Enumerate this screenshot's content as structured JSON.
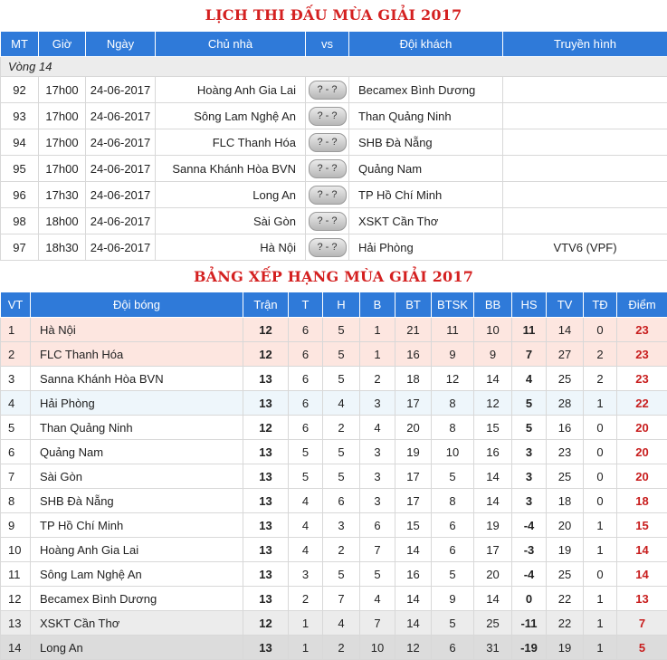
{
  "schedule": {
    "title": "LỊCH THI ĐẤU MÙA GIẢI 2017",
    "headers": [
      "MT",
      "Giờ",
      "Ngày",
      "Chủ nhà",
      "vs",
      "Đội khách",
      "Truyền hình"
    ],
    "round_label": "Vòng 14",
    "matches": [
      {
        "mt": "92",
        "time": "17h00",
        "date": "24-06-2017",
        "home": "Hoàng Anh Gia Lai",
        "score": "? - ?",
        "away": "Becamex Bình Dương",
        "tv": ""
      },
      {
        "mt": "93",
        "time": "17h00",
        "date": "24-06-2017",
        "home": "Sông Lam Nghệ An",
        "score": "? - ?",
        "away": "Than Quảng Ninh",
        "tv": ""
      },
      {
        "mt": "94",
        "time": "17h00",
        "date": "24-06-2017",
        "home": "FLC Thanh Hóa",
        "score": "? - ?",
        "away": "SHB Đà Nẵng",
        "tv": ""
      },
      {
        "mt": "95",
        "time": "17h00",
        "date": "24-06-2017",
        "home": "Sanna Khánh Hòa BVN",
        "score": "? - ?",
        "away": "Quảng Nam",
        "tv": ""
      },
      {
        "mt": "96",
        "time": "17h30",
        "date": "24-06-2017",
        "home": "Long An",
        "score": "? - ?",
        "away": "TP Hồ Chí Minh",
        "tv": ""
      },
      {
        "mt": "98",
        "time": "18h00",
        "date": "24-06-2017",
        "home": "Sài Gòn",
        "score": "? - ?",
        "away": "XSKT Cần Thơ",
        "tv": ""
      },
      {
        "mt": "97",
        "time": "18h30",
        "date": "24-06-2017",
        "home": "Hà Nội",
        "score": "? - ?",
        "away": "Hải Phòng",
        "tv": "VTV6 (VPF)"
      }
    ]
  },
  "standings": {
    "title": "BẢNG XẾP HẠNG MÙA GIẢI 2017",
    "headers": [
      "VT",
      "Đội bóng",
      "Trận",
      "T",
      "H",
      "B",
      "BT",
      "BTSK",
      "BB",
      "HS",
      "TV",
      "TĐ",
      "Điểm"
    ],
    "rows": [
      {
        "pos": "1",
        "team": "Hà Nội",
        "played": "12",
        "w": "6",
        "d": "5",
        "l": "1",
        "gf": "21",
        "gfa": "11",
        "ga": "10",
        "gd": "11",
        "yc": "14",
        "rc": "0",
        "pts": "23",
        "zone": "top"
      },
      {
        "pos": "2",
        "team": "FLC Thanh Hóa",
        "played": "12",
        "w": "6",
        "d": "5",
        "l": "1",
        "gf": "16",
        "gfa": "9",
        "ga": "9",
        "gd": "7",
        "yc": "27",
        "rc": "2",
        "pts": "23",
        "zone": "top"
      },
      {
        "pos": "3",
        "team": "Sanna Khánh Hòa BVN",
        "played": "13",
        "w": "6",
        "d": "5",
        "l": "2",
        "gf": "18",
        "gfa": "12",
        "ga": "14",
        "gd": "4",
        "yc": "25",
        "rc": "2",
        "pts": "23",
        "zone": ""
      },
      {
        "pos": "4",
        "team": "Hải Phòng",
        "played": "13",
        "w": "6",
        "d": "4",
        "l": "3",
        "gf": "17",
        "gfa": "8",
        "ga": "12",
        "gd": "5",
        "yc": "28",
        "rc": "1",
        "pts": "22",
        "zone": "qual"
      },
      {
        "pos": "5",
        "team": "Than Quảng Ninh",
        "played": "12",
        "w": "6",
        "d": "2",
        "l": "4",
        "gf": "20",
        "gfa": "8",
        "ga": "15",
        "gd": "5",
        "yc": "16",
        "rc": "0",
        "pts": "20",
        "zone": ""
      },
      {
        "pos": "6",
        "team": "Quảng Nam",
        "played": "13",
        "w": "5",
        "d": "5",
        "l": "3",
        "gf": "19",
        "gfa": "10",
        "ga": "16",
        "gd": "3",
        "yc": "23",
        "rc": "0",
        "pts": "20",
        "zone": ""
      },
      {
        "pos": "7",
        "team": "Sài Gòn",
        "played": "13",
        "w": "5",
        "d": "5",
        "l": "3",
        "gf": "17",
        "gfa": "5",
        "ga": "14",
        "gd": "3",
        "yc": "25",
        "rc": "0",
        "pts": "20",
        "zone": ""
      },
      {
        "pos": "8",
        "team": "SHB Đà Nẵng",
        "played": "13",
        "w": "4",
        "d": "6",
        "l": "3",
        "gf": "17",
        "gfa": "8",
        "ga": "14",
        "gd": "3",
        "yc": "18",
        "rc": "0",
        "pts": "18",
        "zone": ""
      },
      {
        "pos": "9",
        "team": "TP Hồ Chí Minh",
        "played": "13",
        "w": "4",
        "d": "3",
        "l": "6",
        "gf": "15",
        "gfa": "6",
        "ga": "19",
        "gd": "-4",
        "yc": "20",
        "rc": "1",
        "pts": "15",
        "zone": ""
      },
      {
        "pos": "10",
        "team": "Hoàng Anh Gia Lai",
        "played": "13",
        "w": "4",
        "d": "2",
        "l": "7",
        "gf": "14",
        "gfa": "6",
        "ga": "17",
        "gd": "-3",
        "yc": "19",
        "rc": "1",
        "pts": "14",
        "zone": ""
      },
      {
        "pos": "11",
        "team": "Sông Lam Nghệ An",
        "played": "13",
        "w": "3",
        "d": "5",
        "l": "5",
        "gf": "16",
        "gfa": "5",
        "ga": "20",
        "gd": "-4",
        "yc": "25",
        "rc": "0",
        "pts": "14",
        "zone": ""
      },
      {
        "pos": "12",
        "team": "Becamex Bình Dương",
        "played": "13",
        "w": "2",
        "d": "7",
        "l": "4",
        "gf": "14",
        "gfa": "9",
        "ga": "14",
        "gd": "0",
        "yc": "22",
        "rc": "1",
        "pts": "13",
        "zone": ""
      },
      {
        "pos": "13",
        "team": "XSKT Cần Thơ",
        "played": "12",
        "w": "1",
        "d": "4",
        "l": "7",
        "gf": "14",
        "gfa": "5",
        "ga": "25",
        "gd": "-11",
        "yc": "22",
        "rc": "1",
        "pts": "7",
        "zone": "rel"
      },
      {
        "pos": "14",
        "team": "Long An",
        "played": "13",
        "w": "1",
        "d": "2",
        "l": "10",
        "gf": "12",
        "gfa": "6",
        "ga": "31",
        "gd": "-19",
        "yc": "19",
        "rc": "1",
        "pts": "5",
        "zone": "rel2"
      }
    ]
  },
  "colors": {
    "header_bg": "#2f7ad9",
    "title_red": "#d42020",
    "points_red": "#c81e1e",
    "top_zone": "#fde6e0",
    "qual_zone": "#eef6fb",
    "relegation_zone": "#ececec"
  }
}
